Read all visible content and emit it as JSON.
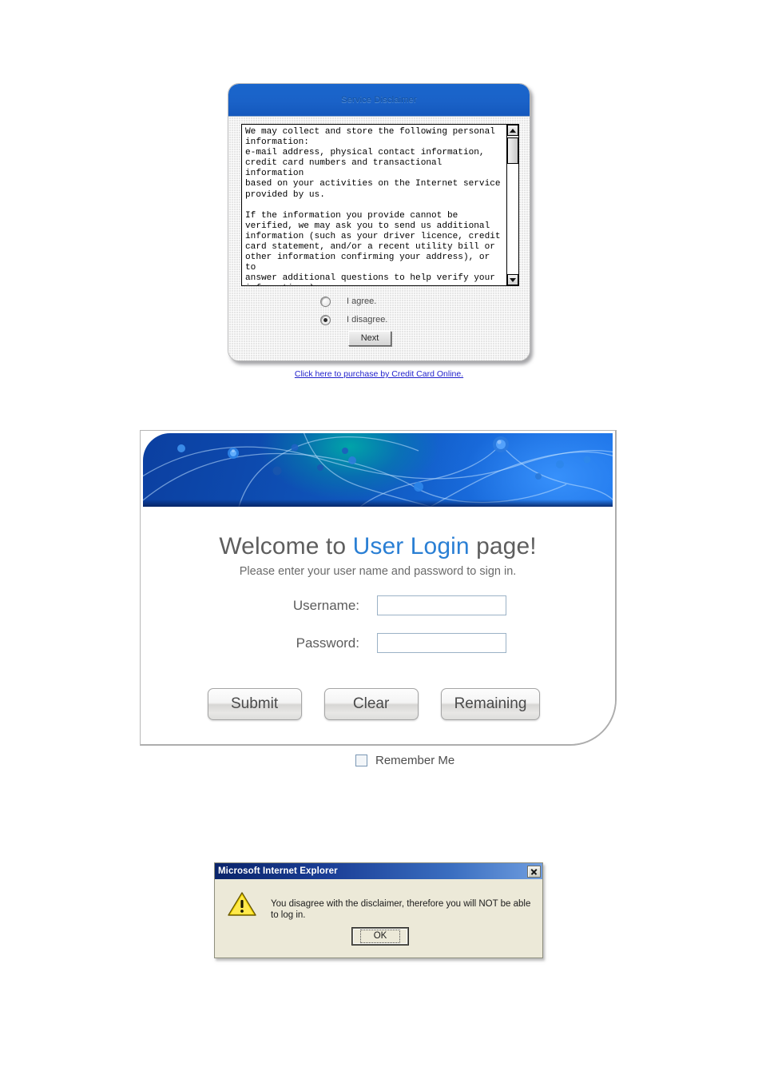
{
  "disclaimer_dialog": {
    "title": "Service Disclaimer",
    "body_text": "We may collect and store the following personal\ninformation:\ne-mail address, physical contact information,\ncredit card numbers and transactional information\nbased on your activities on the Internet service\nprovided by us.\n\nIf the information you provide cannot be\nverified, we may ask you to send us additional\ninformation (such as your driver licence, credit\ncard statement, and/or a recent utility bill or\nother information confirming your address), or to\nanswer additional questions to help verify your\ninformation.)",
    "options": [
      {
        "label": "I agree.",
        "selected": false
      },
      {
        "label": "I disagree.",
        "selected": true
      }
    ],
    "next_label": "Next",
    "purchase_link": "Click here to purchase by Credit Card Online.",
    "title_color": "#15529f",
    "titlebar_color": "#1a62c8",
    "link_color": "#2222cc"
  },
  "login_panel": {
    "welcome_prefix": "Welcome to ",
    "welcome_highlight": "User Login",
    "welcome_suffix": " page!",
    "subtitle": "Please enter your user name and password  to sign in.",
    "fields": [
      {
        "label": "Username:",
        "value": "",
        "placeholder": ""
      },
      {
        "label": "Password:",
        "value": "",
        "placeholder": ""
      }
    ],
    "buttons": [
      {
        "label": "Submit"
      },
      {
        "label": "Clear"
      },
      {
        "label": "Remaining"
      }
    ],
    "remember_me": {
      "label": "Remember Me",
      "checked": false
    },
    "highlight_color": "#2a7fd4",
    "banner_color": "#0f57bd"
  },
  "ie_dialog": {
    "title": "Microsoft Internet Explorer",
    "message": "You disagree with the disclaimer, therefore you will NOT be able to log in.",
    "ok_label": "OK",
    "icon": "warning-icon",
    "titlebar_color": "#0a246a",
    "background_color": "#ece9d8"
  }
}
